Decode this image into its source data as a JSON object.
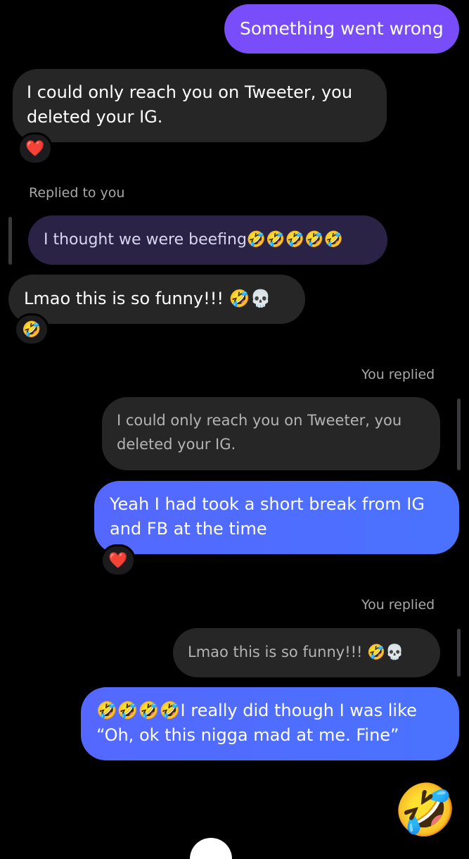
{
  "messages": [
    {
      "text": "Something went wrong"
    },
    {
      "text": "I could only reach you on Tweeter, you deleted your IG.",
      "reaction": "❤️"
    },
    {
      "reply_label": "Replied to you",
      "quote": "I thought we were beefing🤣🤣🤣🤣🤣"
    },
    {
      "text": "Lmao this is so funny!!! 🤣💀",
      "reaction": "🤣"
    },
    {
      "reply_label": "You replied",
      "quote": "I could only reach you on Tweeter, you deleted your IG."
    },
    {
      "text": "Yeah I had took a short break from IG and FB at the time",
      "reaction": "❤️"
    },
    {
      "reply_label": "You replied",
      "quote": "Lmao this is so funny!!! 🤣💀"
    },
    {
      "text": "🤣🤣🤣🤣I really did though I was like “Oh, ok this nigga mad at me. Fine”"
    },
    {
      "text": "🤣"
    }
  ],
  "colors": {
    "background": "#000000",
    "sent_bubble": "#4f6cff",
    "purple_bubble": "#7a4dfa",
    "received_bubble": "#262626",
    "meta_text": "#a8a8a8"
  },
  "icons": {
    "heart": "heart-icon",
    "laughing": "rofl-emoji-icon",
    "skull": "skull-emoji-icon"
  }
}
